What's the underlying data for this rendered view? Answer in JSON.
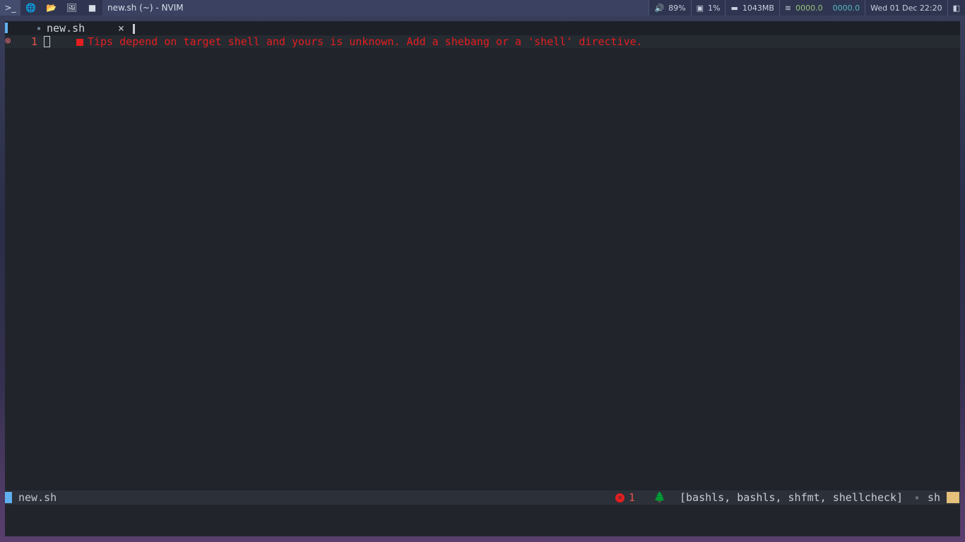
{
  "topbar": {
    "launchers": [
      {
        "icon": "terminal-icon",
        "glyph": ">_"
      },
      {
        "icon": "globe-icon",
        "glyph": "🌐"
      },
      {
        "icon": "folder-icon",
        "glyph": "📂"
      },
      {
        "icon": "image-icon",
        "glyph": "🖼"
      },
      {
        "icon": "video-camera-icon",
        "glyph": "■"
      }
    ],
    "window_title": "new.sh (~) - NVIM",
    "volume": "89%",
    "cpu": "1%",
    "memory": "1043MB",
    "net_down": "0000.0",
    "net_up": "0000.0",
    "datetime": "Wed 01 Dec 22:20",
    "colors": {
      "net_down": "#98c379",
      "net_up": "#56b6c2"
    }
  },
  "editor": {
    "tab": {
      "name": "new.sh",
      "close": "×",
      "file_icon": "terminal-file-icon"
    },
    "line": {
      "number": "1",
      "sign": "⊗"
    },
    "diagnostic": "Tips depend on target shell and yours is unknown. Add a shebang or a 'shell' directive.",
    "colors": {
      "error": "#e31f1f",
      "accent": "#61afef"
    }
  },
  "statusline": {
    "filename": "new.sh",
    "error_count": "1",
    "lsp_clients": "[bashls, bashls, shfmt, shellcheck]",
    "filetype": "sh",
    "colors": {
      "mode": "#61afef",
      "end": "#e5c07b"
    }
  }
}
